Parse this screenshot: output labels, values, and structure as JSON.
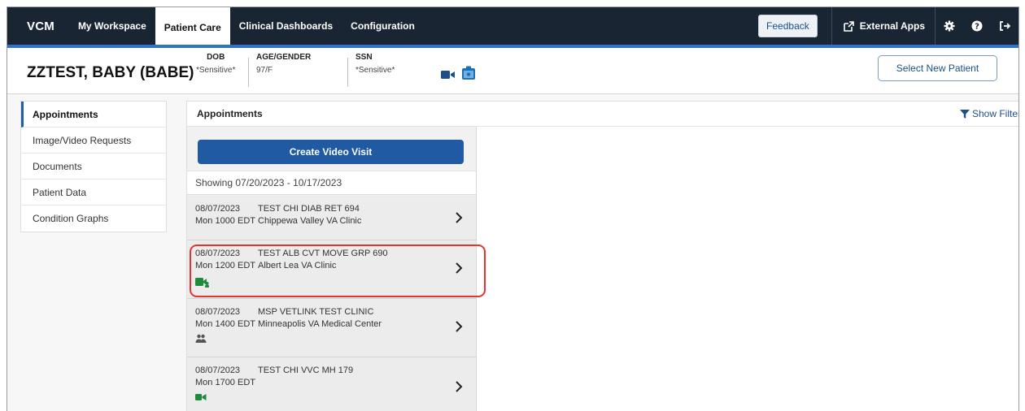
{
  "nav": {
    "brand": "VCM",
    "items": [
      {
        "label": "My Workspace",
        "active": false
      },
      {
        "label": "Patient Care",
        "active": true
      },
      {
        "label": "Clinical Dashboards",
        "active": false
      },
      {
        "label": "Configuration",
        "active": false
      }
    ],
    "feedback_label": "Feedback",
    "external_apps_label": "External Apps",
    "icons": [
      "gear-icon",
      "help-icon",
      "logout-icon"
    ]
  },
  "patient": {
    "name": "ZZTEST, BABY (BABE)",
    "dob_label": "DOB",
    "dob_value": "*Sensitive*",
    "age_gender_label": "AGE/GENDER",
    "age_gender_value": "97/F",
    "ssn_label": "SSN",
    "ssn_value": "*Sensitive*",
    "select_new_label": "Select New Patient"
  },
  "sidebar": {
    "items": [
      {
        "label": "Appointments",
        "active": true
      },
      {
        "label": "Image/Video Requests",
        "active": false
      },
      {
        "label": "Documents",
        "active": false
      },
      {
        "label": "Patient Data",
        "active": false
      },
      {
        "label": "Condition Graphs",
        "active": false
      }
    ]
  },
  "main": {
    "title": "Appointments",
    "show_filter_label": "Show Filter",
    "create_video_visit_label": "Create Video Visit",
    "range_text": "Showing 07/20/2023 - 10/17/2023",
    "appointments": [
      {
        "date": "08/07/2023",
        "time": "Mon 1000 EDT",
        "name": "TEST CHI DIAB RET 694",
        "location": "Chippewa Valley VA Clinic",
        "modality": "none"
      },
      {
        "date": "08/07/2023",
        "time": "Mon 1200 EDT",
        "name": "TEST ALB CVT MOVE GRP 690",
        "location": "Albert Lea VA Clinic",
        "modality": "group-video-icon"
      },
      {
        "date": "08/07/2023",
        "time": "Mon 1400 EDT",
        "name": "MSP VETLINK TEST CLINIC",
        "location": "Minneapolis VA Medical Center",
        "modality": "in-person-icon"
      },
      {
        "date": "08/07/2023",
        "time": "Mon 1700 EDT",
        "name": "TEST CHI VVC MH 179",
        "location": "",
        "modality": "video-icon"
      }
    ]
  },
  "colors": {
    "nav_bg": "#1a2533",
    "accent_blue": "#2f72c9",
    "button_blue": "#1f5aa3",
    "video_green": "#1f8a3c",
    "highlight_red": "#e3342f"
  }
}
